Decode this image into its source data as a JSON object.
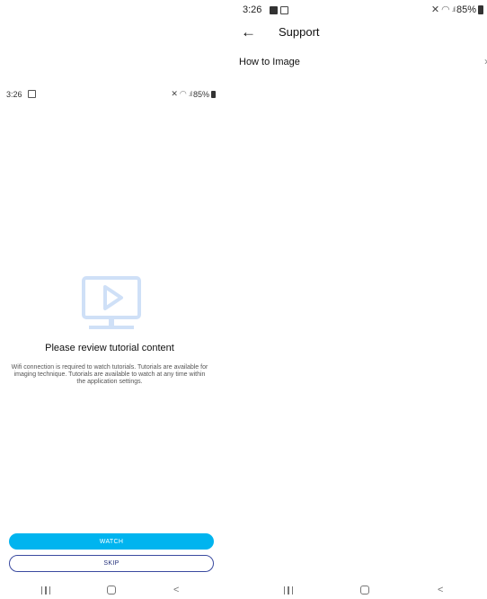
{
  "left_screen": {
    "status_bar": {
      "time": "3:26",
      "battery": "85%"
    },
    "tutorial": {
      "icon": "video-tutorial-icon",
      "title": "Please review tutorial content",
      "body": "Wifi connection is required to watch tutorials. Tutorials are available for imaging technique. Tutorials are available to watch at any time within the application settings."
    },
    "buttons": {
      "watch": "WATCH",
      "skip": "SKIP"
    },
    "nav": {
      "recents": "recents-icon",
      "home": "home-icon",
      "back": "back-icon"
    }
  },
  "right_screen": {
    "status_bar": {
      "time": "3:26",
      "battery": "85%"
    },
    "appbar": {
      "title": "Support",
      "back_icon": "arrow-left-icon"
    },
    "items": [
      {
        "label": "How to Image",
        "icon": "chevron-right-icon"
      }
    ],
    "nav": {
      "recents": "recents-icon",
      "home": "home-icon",
      "back": "back-icon"
    }
  },
  "colors": {
    "accent": "#00b4ef",
    "skip_border": "#3a4aa0",
    "tutorial_icon": "#cfe0f7"
  }
}
